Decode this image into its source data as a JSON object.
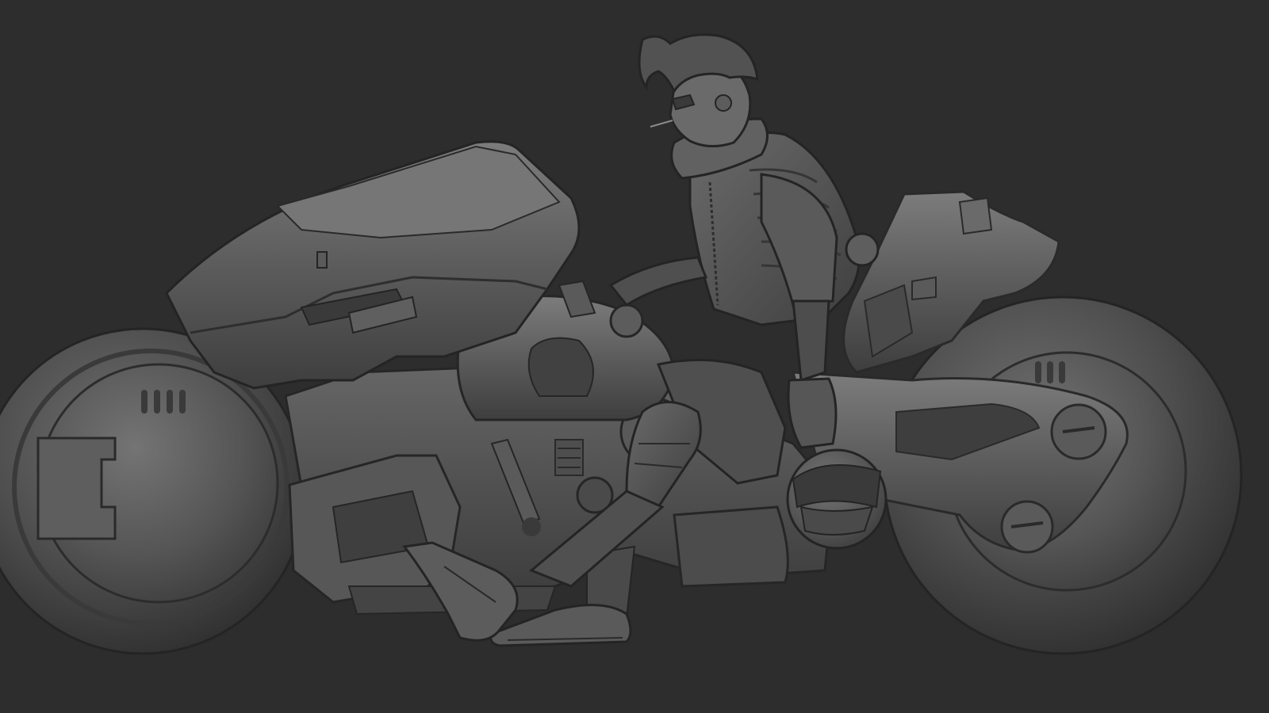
{
  "viewport": {
    "background_color": "#2d2d2d",
    "material": "clay-gray-matcap",
    "object_colors": {
      "base": "#555555",
      "light": "#7a7a7a",
      "highlight": "#8c8c8c",
      "shadow": "#3a3a3a",
      "deep": "#262626"
    }
  },
  "model": {
    "subject": "rider-on-futuristic-motorcycle",
    "view": "side-profile-left"
  }
}
